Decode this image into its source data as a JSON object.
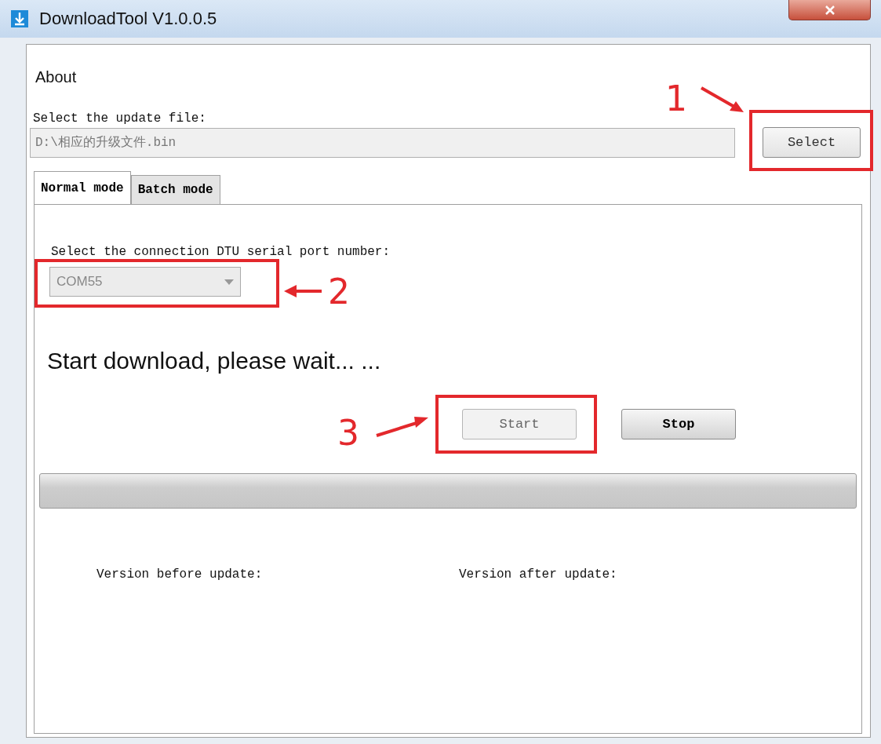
{
  "window": {
    "title": "DownloadTool V1.0.0.5"
  },
  "menu": [
    {
      "label": "About"
    }
  ],
  "file": {
    "label": "Select the update file:",
    "value": "D:\\相应的升级文件.bin",
    "disabled": true
  },
  "select_button": {
    "label": "Select"
  },
  "tabs": [
    {
      "label": "Normal mode",
      "selected": true
    },
    {
      "label": "Batch mode",
      "selected": false
    }
  ],
  "port": {
    "label": "Select the connection DTU serial port number:",
    "value": "COM55",
    "disabled": true
  },
  "status": "Start download, please wait... ...",
  "buttons": [
    {
      "label": "Start",
      "disabled": true
    },
    {
      "label": "Stop",
      "disabled": false
    }
  ],
  "progress": {
    "level": 0
  },
  "versions": [
    {
      "label": "Version before update:"
    },
    {
      "label": "Version after update:"
    }
  ],
  "annotations": [
    {
      "label": "1"
    },
    {
      "label": "2"
    },
    {
      "label": "3"
    }
  ]
}
